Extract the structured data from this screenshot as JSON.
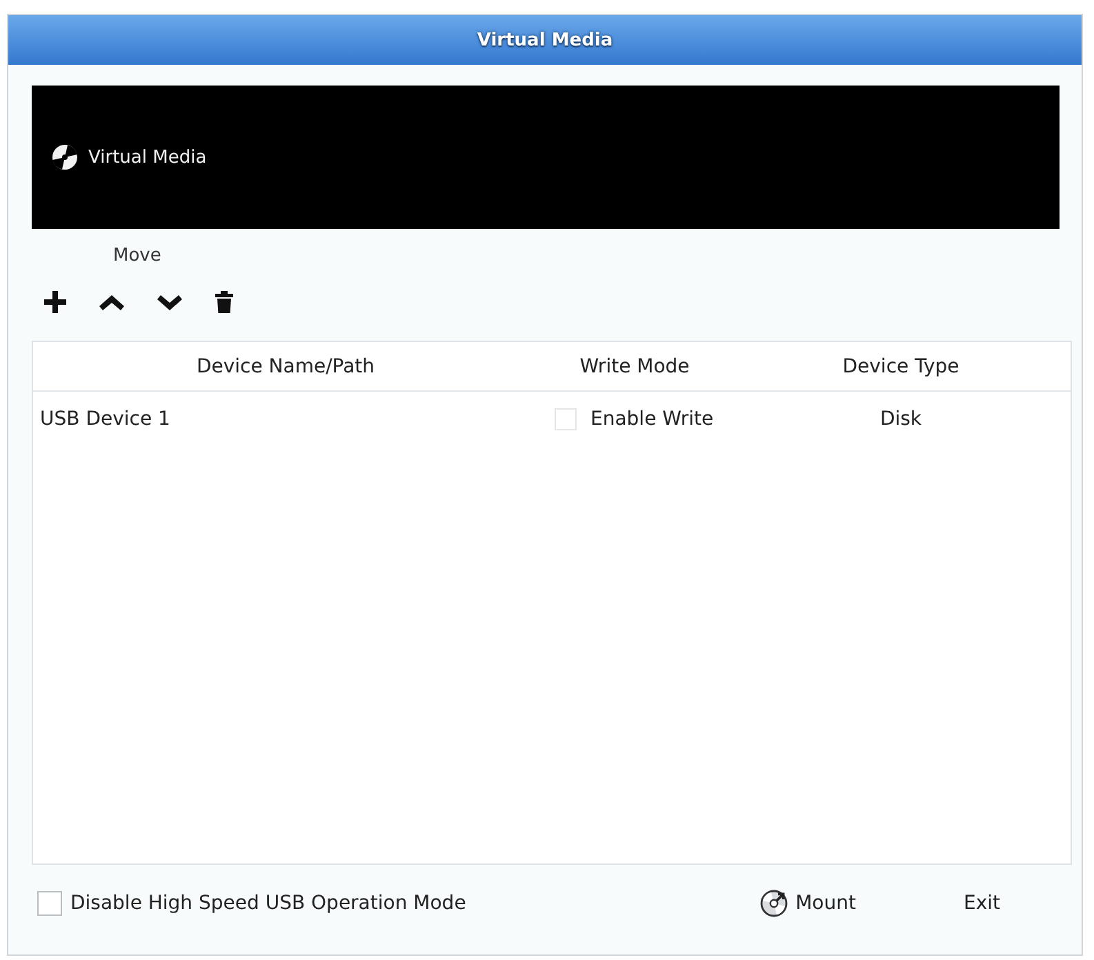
{
  "window": {
    "title": "Virtual Media"
  },
  "banner": {
    "title": "Virtual Media"
  },
  "toolbar": {
    "move_label": "Move",
    "buttons": [
      {
        "kind": "add"
      },
      {
        "kind": "up"
      },
      {
        "kind": "down"
      },
      {
        "kind": "delete"
      }
    ]
  },
  "table": {
    "columns": [
      "Device Name/Path",
      "Write Mode",
      "Device Type"
    ],
    "rows": [
      {
        "device": "USB Device 1",
        "write_mode": {
          "label": "Enable Write",
          "checked": false
        },
        "device_type": "Disk"
      }
    ]
  },
  "footer": {
    "high_speed_option": {
      "label": "Disable High Speed USB Operation Mode",
      "checked": false
    },
    "buttons": [
      {
        "kind": "mount",
        "label": "Mount"
      },
      {
        "kind": "exit",
        "label": "Exit"
      }
    ]
  }
}
